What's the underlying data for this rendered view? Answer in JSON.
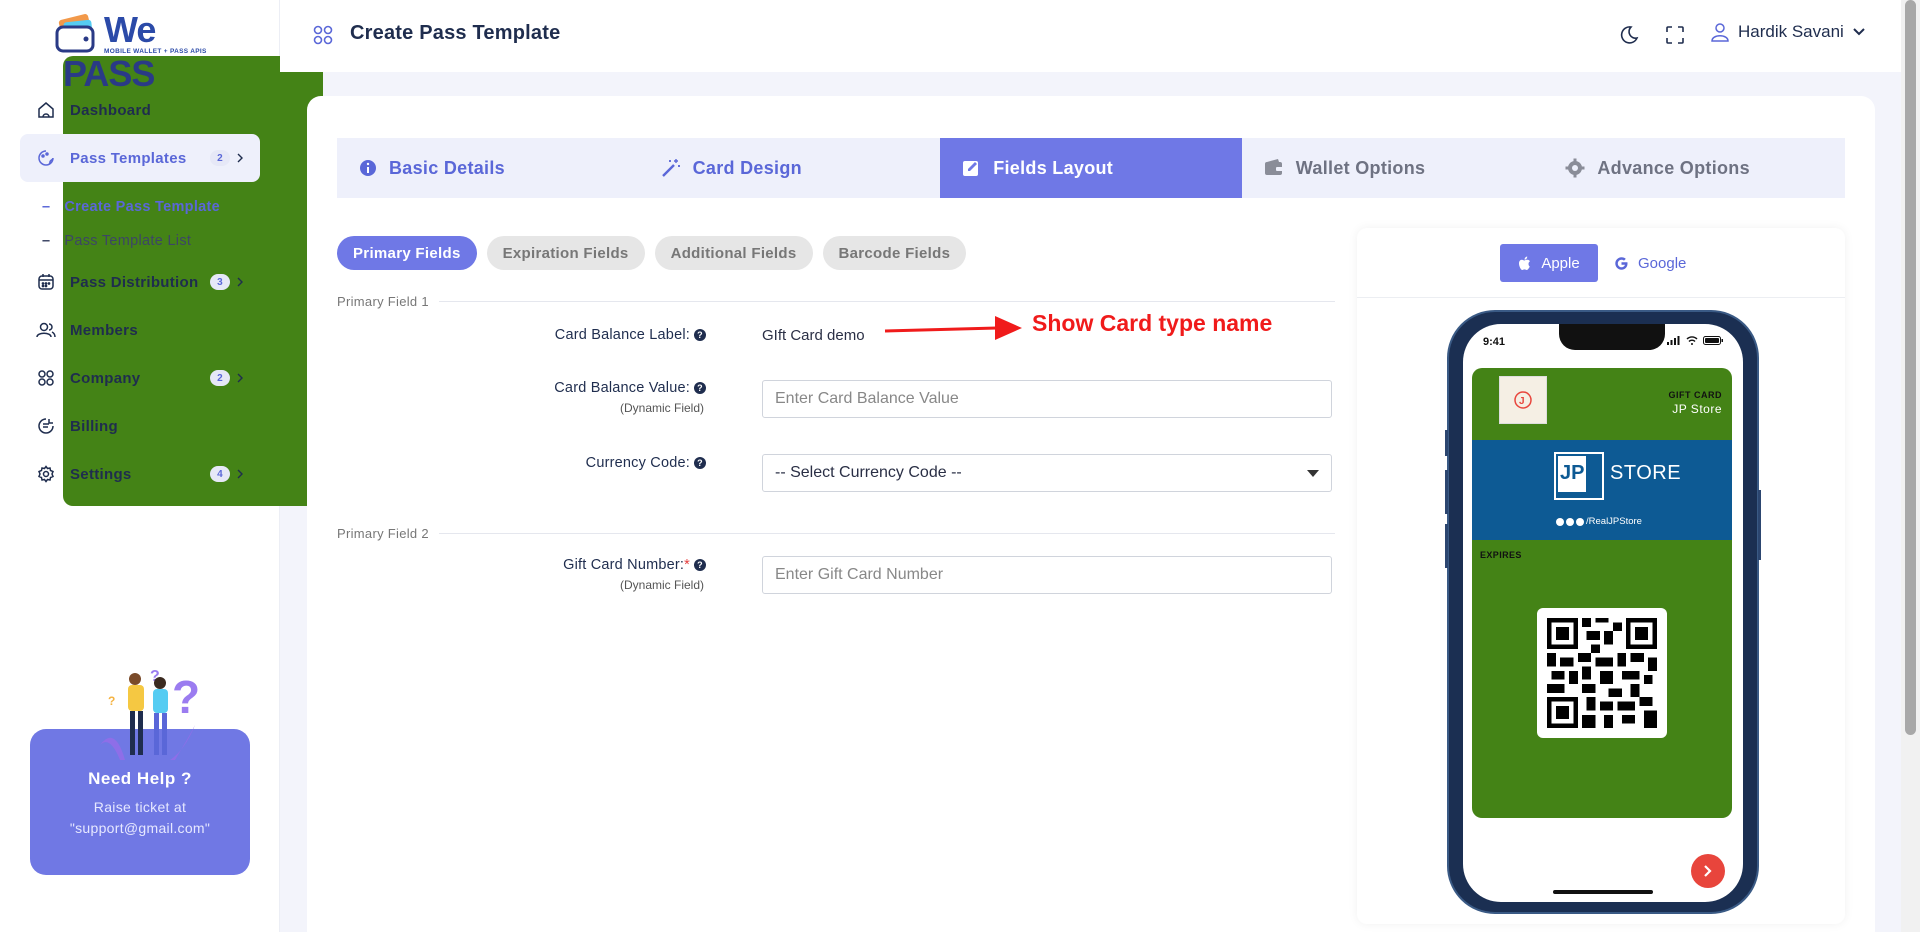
{
  "brand": {
    "logo_main_a": "We",
    "logo_main_b": "PASS",
    "logo_sub": "MOBILE WALLET + PASS APIS"
  },
  "sidebar": {
    "items": [
      {
        "label": "Dashboard",
        "icon": "home-icon"
      },
      {
        "label": "Pass Templates",
        "icon": "palette-icon",
        "badge": "2"
      },
      {
        "label": "Pass Distribution",
        "icon": "calendar-icon",
        "badge": "3"
      },
      {
        "label": "Members",
        "icon": "users-icon"
      },
      {
        "label": "Company",
        "icon": "grid-icon",
        "badge": "2"
      },
      {
        "label": "Billing",
        "icon": "receipt-icon"
      },
      {
        "label": "Settings",
        "icon": "gear-icon",
        "badge": "4"
      }
    ],
    "subitems": [
      {
        "label": "Create Pass Template"
      },
      {
        "label": "Pass Template List"
      }
    ],
    "help": {
      "title": "Need Help ?",
      "line1": "Raise ticket at",
      "line2": "\"support@gmail.com\""
    }
  },
  "header": {
    "title": "Create Pass Template",
    "user_name": "Hardik Savani"
  },
  "wizard": {
    "tabs": [
      {
        "label": "Basic Details",
        "icon": "info-icon"
      },
      {
        "label": "Card Design",
        "icon": "magic-wand-icon"
      },
      {
        "label": "Fields Layout",
        "icon": "edit-icon"
      },
      {
        "label": "Wallet Options",
        "icon": "wallet-icon"
      },
      {
        "label": "Advance Options",
        "icon": "gear-icon"
      }
    ]
  },
  "field_tabs": [
    {
      "label": "Primary Fields"
    },
    {
      "label": "Expiration Fields"
    },
    {
      "label": "Additional Fields"
    },
    {
      "label": "Barcode Fields"
    }
  ],
  "form": {
    "section1": "Primary Field 1",
    "section2": "Primary Field 2",
    "balance_label": {
      "label": "Card Balance Label:",
      "value": "GIft Card demo"
    },
    "balance_value": {
      "label": "Card Balance Value:",
      "sub": "(Dynamic Field)",
      "placeholder": "Enter Card Balance Value"
    },
    "currency": {
      "label": "Currency Code:",
      "selected": "-- Select Currency Code --"
    },
    "gift_number": {
      "label": "Gift Card Number:",
      "required": "*",
      "sub": "(Dynamic Field)",
      "placeholder": "Enter Gift Card Number"
    }
  },
  "annotation": {
    "text": "Show Card type name",
    "color": "#f01b1b"
  },
  "preview": {
    "apple_label": "Apple",
    "google_label": "Google",
    "time": "9:41",
    "pass_type": "GIFT CARD",
    "store_name": "JP Store",
    "banner_jp": "JP",
    "banner_store": "STORE",
    "banner_social": "/RealJPStore",
    "expires_label": "EXPIRES",
    "pass_color": "#448316",
    "banner_color": "#0d5a94"
  },
  "colors": {
    "accent": "#6f78e6",
    "text_dark": "#1f2d4e"
  }
}
